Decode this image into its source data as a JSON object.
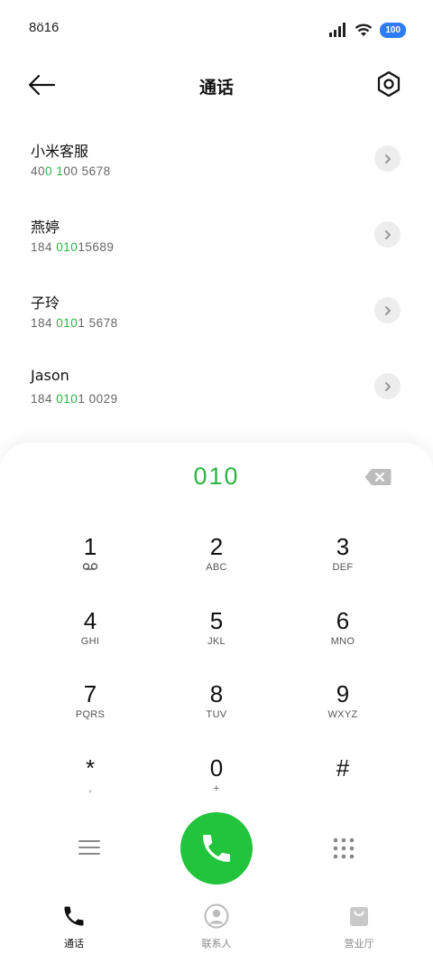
{
  "status_bar": {
    "time": "8ö16",
    "battery": "100"
  },
  "header": {
    "title": "通话"
  },
  "contacts": [
    {
      "name": "小米客服",
      "number_parts": [
        "40",
        "0",
        " ",
        "1",
        "00",
        " 5678"
      ]
    },
    {
      "name": "燕婷",
      "number_parts": [
        "184 ",
        "010",
        "15689"
      ]
    },
    {
      "name": "子玲",
      "number_parts": [
        "184 ",
        "010",
        "1 5678"
      ]
    },
    {
      "name": "Jason",
      "number_parts": [
        "184 ",
        "010",
        "1 0029"
      ]
    }
  ],
  "dialer": {
    "display": "010"
  },
  "keypad": [
    {
      "digit": "1",
      "letters": ""
    },
    {
      "digit": "2",
      "letters": "ABC"
    },
    {
      "digit": "3",
      "letters": "DEF"
    },
    {
      "digit": "4",
      "letters": "GHI"
    },
    {
      "digit": "5",
      "letters": "JKL"
    },
    {
      "digit": "6",
      "letters": "MNO"
    },
    {
      "digit": "7",
      "letters": "PQRS"
    },
    {
      "digit": "8",
      "letters": "TUV"
    },
    {
      "digit": "9",
      "letters": "WXYZ"
    },
    {
      "digit": "*",
      "letters": ","
    },
    {
      "digit": "0",
      "letters": "+"
    },
    {
      "digit": "#",
      "letters": ""
    }
  ],
  "tabs": [
    {
      "label": "通话",
      "icon": "phone-icon",
      "active": true
    },
    {
      "label": "联系人",
      "icon": "contact-icon",
      "active": false
    },
    {
      "label": "营业厅",
      "icon": "bag-icon",
      "active": false
    }
  ],
  "colors": {
    "accent_green": "#2bb543",
    "call_button": "#22c43c",
    "battery_blue": "#2e7cf6"
  }
}
